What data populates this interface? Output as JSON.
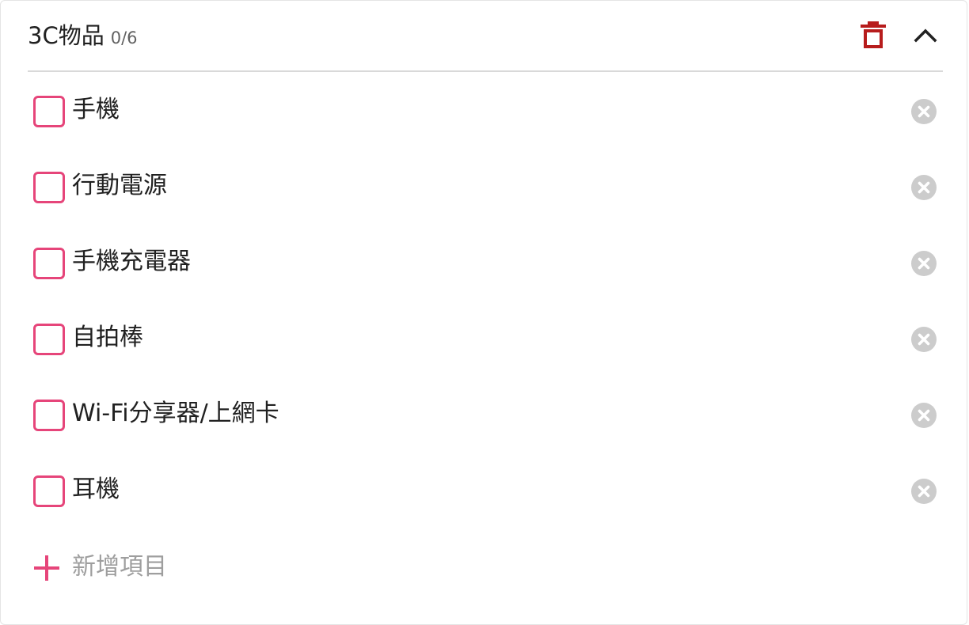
{
  "group": {
    "title": "3C物品",
    "count": "0/6",
    "accent_color": "#e6457a",
    "delete_color": "#b71c1c"
  },
  "items": [
    {
      "label": "手機",
      "checked": false
    },
    {
      "label": "行動電源",
      "checked": false
    },
    {
      "label": "手機充電器",
      "checked": false
    },
    {
      "label": "自拍棒",
      "checked": false
    },
    {
      "label": "Wi-Fi分享器/上網卡",
      "checked": false
    },
    {
      "label": "耳機",
      "checked": false
    }
  ],
  "icons": {
    "delete_group": "trash-icon",
    "collapse": "chevron-up-icon",
    "remove_item": "close-circle-icon",
    "add_item": "plus-icon"
  },
  "add_item": {
    "label": "新增項目"
  }
}
